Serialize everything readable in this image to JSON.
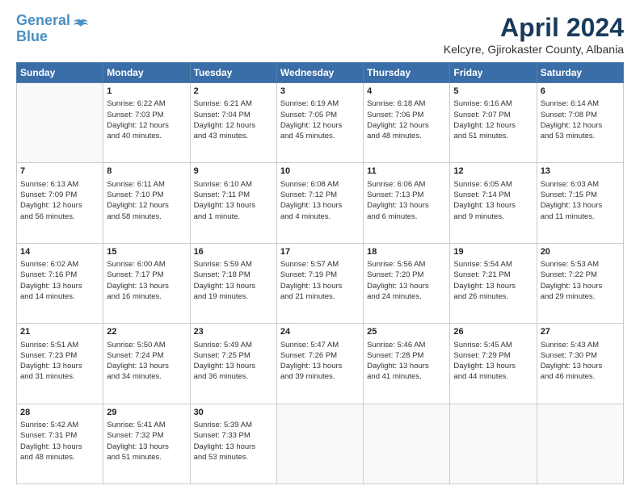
{
  "logo": {
    "line1": "General",
    "line2": "Blue",
    "tagline": ""
  },
  "header": {
    "month_year": "April 2024",
    "location": "Kelcyre, Gjirokaster County, Albania"
  },
  "days_of_week": [
    "Sunday",
    "Monday",
    "Tuesday",
    "Wednesday",
    "Thursday",
    "Friday",
    "Saturday"
  ],
  "weeks": [
    [
      {
        "day": "",
        "info": ""
      },
      {
        "day": "1",
        "info": "Sunrise: 6:22 AM\nSunset: 7:03 PM\nDaylight: 12 hours\nand 40 minutes."
      },
      {
        "day": "2",
        "info": "Sunrise: 6:21 AM\nSunset: 7:04 PM\nDaylight: 12 hours\nand 43 minutes."
      },
      {
        "day": "3",
        "info": "Sunrise: 6:19 AM\nSunset: 7:05 PM\nDaylight: 12 hours\nand 45 minutes."
      },
      {
        "day": "4",
        "info": "Sunrise: 6:18 AM\nSunset: 7:06 PM\nDaylight: 12 hours\nand 48 minutes."
      },
      {
        "day": "5",
        "info": "Sunrise: 6:16 AM\nSunset: 7:07 PM\nDaylight: 12 hours\nand 51 minutes."
      },
      {
        "day": "6",
        "info": "Sunrise: 6:14 AM\nSunset: 7:08 PM\nDaylight: 12 hours\nand 53 minutes."
      }
    ],
    [
      {
        "day": "7",
        "info": "Sunrise: 6:13 AM\nSunset: 7:09 PM\nDaylight: 12 hours\nand 56 minutes."
      },
      {
        "day": "8",
        "info": "Sunrise: 6:11 AM\nSunset: 7:10 PM\nDaylight: 12 hours\nand 58 minutes."
      },
      {
        "day": "9",
        "info": "Sunrise: 6:10 AM\nSunset: 7:11 PM\nDaylight: 13 hours\nand 1 minute."
      },
      {
        "day": "10",
        "info": "Sunrise: 6:08 AM\nSunset: 7:12 PM\nDaylight: 13 hours\nand 4 minutes."
      },
      {
        "day": "11",
        "info": "Sunrise: 6:06 AM\nSunset: 7:13 PM\nDaylight: 13 hours\nand 6 minutes."
      },
      {
        "day": "12",
        "info": "Sunrise: 6:05 AM\nSunset: 7:14 PM\nDaylight: 13 hours\nand 9 minutes."
      },
      {
        "day": "13",
        "info": "Sunrise: 6:03 AM\nSunset: 7:15 PM\nDaylight: 13 hours\nand 11 minutes."
      }
    ],
    [
      {
        "day": "14",
        "info": "Sunrise: 6:02 AM\nSunset: 7:16 PM\nDaylight: 13 hours\nand 14 minutes."
      },
      {
        "day": "15",
        "info": "Sunrise: 6:00 AM\nSunset: 7:17 PM\nDaylight: 13 hours\nand 16 minutes."
      },
      {
        "day": "16",
        "info": "Sunrise: 5:59 AM\nSunset: 7:18 PM\nDaylight: 13 hours\nand 19 minutes."
      },
      {
        "day": "17",
        "info": "Sunrise: 5:57 AM\nSunset: 7:19 PM\nDaylight: 13 hours\nand 21 minutes."
      },
      {
        "day": "18",
        "info": "Sunrise: 5:56 AM\nSunset: 7:20 PM\nDaylight: 13 hours\nand 24 minutes."
      },
      {
        "day": "19",
        "info": "Sunrise: 5:54 AM\nSunset: 7:21 PM\nDaylight: 13 hours\nand 26 minutes."
      },
      {
        "day": "20",
        "info": "Sunrise: 5:53 AM\nSunset: 7:22 PM\nDaylight: 13 hours\nand 29 minutes."
      }
    ],
    [
      {
        "day": "21",
        "info": "Sunrise: 5:51 AM\nSunset: 7:23 PM\nDaylight: 13 hours\nand 31 minutes."
      },
      {
        "day": "22",
        "info": "Sunrise: 5:50 AM\nSunset: 7:24 PM\nDaylight: 13 hours\nand 34 minutes."
      },
      {
        "day": "23",
        "info": "Sunrise: 5:49 AM\nSunset: 7:25 PM\nDaylight: 13 hours\nand 36 minutes."
      },
      {
        "day": "24",
        "info": "Sunrise: 5:47 AM\nSunset: 7:26 PM\nDaylight: 13 hours\nand 39 minutes."
      },
      {
        "day": "25",
        "info": "Sunrise: 5:46 AM\nSunset: 7:28 PM\nDaylight: 13 hours\nand 41 minutes."
      },
      {
        "day": "26",
        "info": "Sunrise: 5:45 AM\nSunset: 7:29 PM\nDaylight: 13 hours\nand 44 minutes."
      },
      {
        "day": "27",
        "info": "Sunrise: 5:43 AM\nSunset: 7:30 PM\nDaylight: 13 hours\nand 46 minutes."
      }
    ],
    [
      {
        "day": "28",
        "info": "Sunrise: 5:42 AM\nSunset: 7:31 PM\nDaylight: 13 hours\nand 48 minutes."
      },
      {
        "day": "29",
        "info": "Sunrise: 5:41 AM\nSunset: 7:32 PM\nDaylight: 13 hours\nand 51 minutes."
      },
      {
        "day": "30",
        "info": "Sunrise: 5:39 AM\nSunset: 7:33 PM\nDaylight: 13 hours\nand 53 minutes."
      },
      {
        "day": "",
        "info": ""
      },
      {
        "day": "",
        "info": ""
      },
      {
        "day": "",
        "info": ""
      },
      {
        "day": "",
        "info": ""
      }
    ]
  ]
}
